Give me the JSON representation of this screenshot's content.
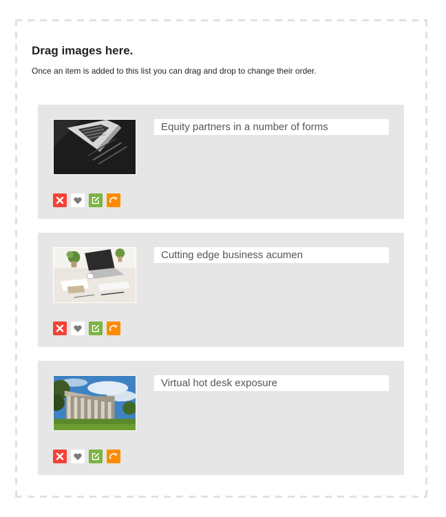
{
  "dropzone": {
    "title": "Drag images here.",
    "description": "Once an item is added to this list you can drag and drop to change their order."
  },
  "items": [
    {
      "caption": "Equity partners in a number of forms",
      "image_icon": "laptop-photo-icon"
    },
    {
      "caption": "Cutting edge business acumen",
      "image_icon": "desk-workspace-photo-icon"
    },
    {
      "caption": "Virtual hot desk exposure",
      "image_icon": "building-columns-photo-icon"
    }
  ],
  "actions": [
    {
      "name": "delete",
      "icon": "close-icon",
      "color": "#f44336"
    },
    {
      "name": "favorite",
      "icon": "heart-icon",
      "color": "#ffffff"
    },
    {
      "name": "edit",
      "icon": "edit-icon",
      "color": "#7cb342"
    },
    {
      "name": "rotate",
      "icon": "rotate-icon",
      "color": "#fb8c00"
    }
  ]
}
